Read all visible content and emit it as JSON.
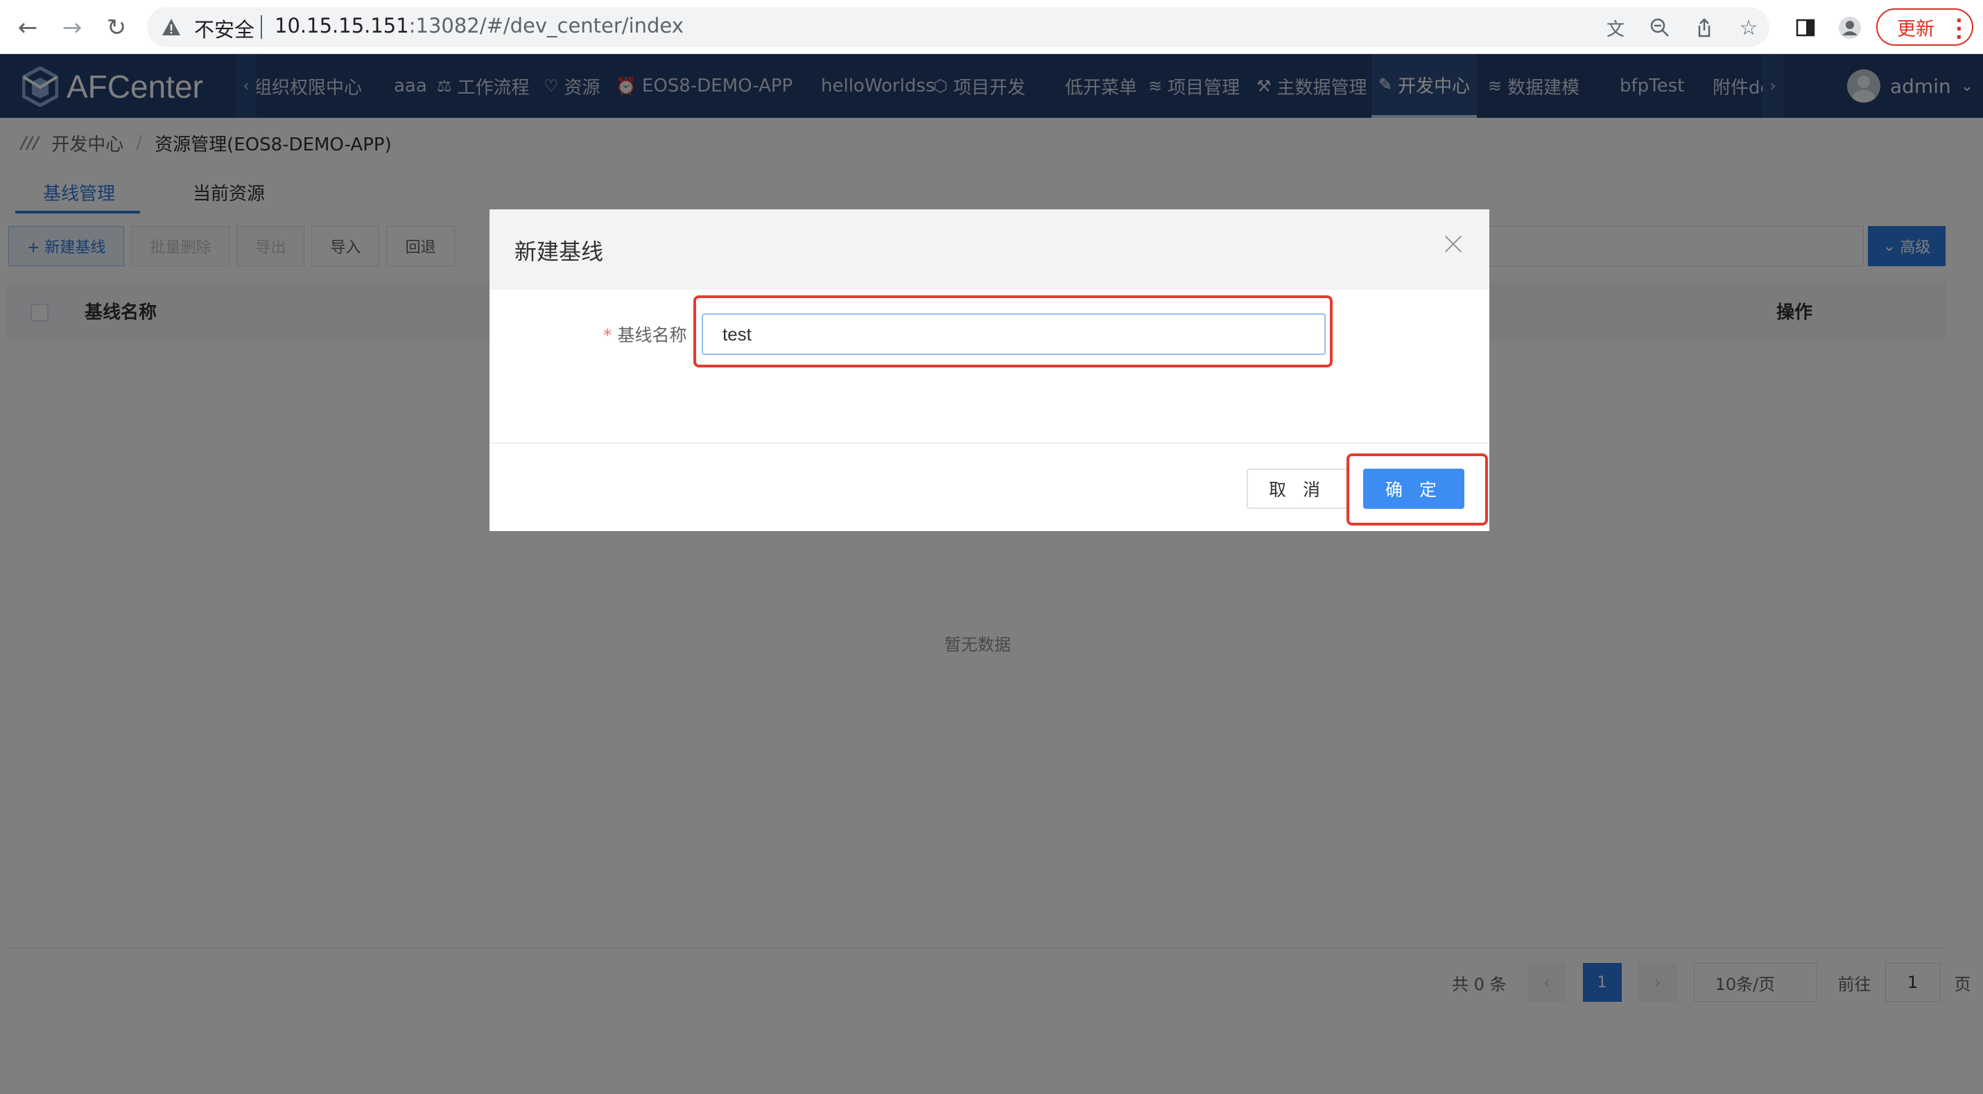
{
  "browser": {
    "security_label": "不安全",
    "url_host": "10.15.15.151",
    "url_rest": ":13082/#/dev_center/index",
    "update_label": "更新"
  },
  "header": {
    "logo_text": "AFCenter",
    "menu": [
      {
        "label": "组织权限中心",
        "icon": ""
      },
      {
        "label": "aaa",
        "icon": ""
      },
      {
        "label": "工作流程",
        "icon": "scale-icon"
      },
      {
        "label": "资源",
        "icon": "shield-icon"
      },
      {
        "label": "EOS8-DEMO-APP",
        "icon": "bell-icon"
      },
      {
        "label": "helloWorldss",
        "icon": ""
      },
      {
        "label": "项目开发",
        "icon": "cube-icon"
      },
      {
        "label": "低开菜单",
        "icon": ""
      },
      {
        "label": "项目管理",
        "icon": "layers-icon"
      },
      {
        "label": "主数据管理",
        "icon": "tools-icon"
      },
      {
        "label": "开发中心",
        "icon": "edit-icon",
        "active": true
      },
      {
        "label": "数据建模",
        "icon": "layers-icon"
      },
      {
        "label": "bfpTest",
        "icon": ""
      },
      {
        "label": "附件de",
        "icon": ""
      }
    ],
    "user_name": "admin"
  },
  "breadcrumb": {
    "root": "开发中心",
    "current": "资源管理(EOS8-DEMO-APP)"
  },
  "tabs": [
    {
      "label": "基线管理",
      "active": true
    },
    {
      "label": "当前资源",
      "active": false
    }
  ],
  "toolbar": {
    "new_label": "+ 新建基线",
    "batch_delete_label": "批量删除",
    "export_label": "导出",
    "import_label": "导入",
    "rollback_label": "回退",
    "advanced_label": "高级"
  },
  "table": {
    "columns": [
      "基线名称",
      "操作"
    ],
    "rows": [],
    "empty_text": "暂无数据"
  },
  "pagination": {
    "total_text": "共 0 条",
    "current_page": "1",
    "page_size": "10条/页",
    "goto_label": "前往",
    "goto_value": "1",
    "page_suffix": "页"
  },
  "dialog": {
    "title": "新建基线",
    "field_required_mark": "*",
    "field_label": "基线名称",
    "field_value": "test",
    "cancel_label": "取 消",
    "confirm_label": "确 定"
  },
  "colors": {
    "header_bg": "#233f6f",
    "primary": "#2d7be0",
    "highlight": "#e33b2e"
  }
}
